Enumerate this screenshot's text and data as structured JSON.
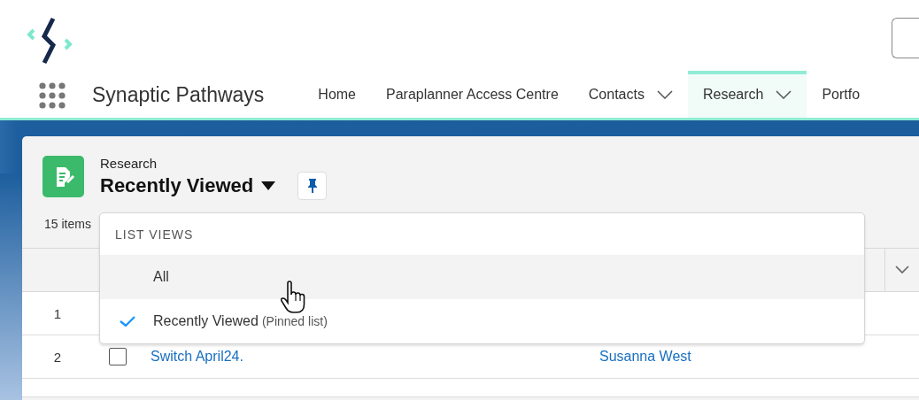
{
  "app": {
    "name": "Synaptic Pathways"
  },
  "nav_tabs": [
    {
      "label": "Home",
      "selected": false,
      "has_menu": false
    },
    {
      "label": "Paraplanner Access Centre",
      "selected": false,
      "has_menu": false
    },
    {
      "label": "Contacts",
      "selected": false,
      "has_menu": true
    },
    {
      "label": "Research",
      "selected": true,
      "has_menu": true
    },
    {
      "label": "Portfo",
      "selected": false,
      "has_menu": false
    }
  ],
  "list_header": {
    "object": "Research",
    "view": "Recently Viewed"
  },
  "item_count": "15 items",
  "table": {
    "rows": [
      {
        "number": "1"
      },
      {
        "number": "2",
        "checked": false,
        "name": "Switch April24.",
        "owner": "Susanna West"
      }
    ]
  },
  "list_views_menu": {
    "heading": "LIST VIEWS",
    "items": [
      {
        "label": "All",
        "selected": false,
        "hovered": true
      },
      {
        "label": "Recently Viewed",
        "note": "(Pinned list)",
        "selected": true,
        "hovered": false
      }
    ]
  }
}
